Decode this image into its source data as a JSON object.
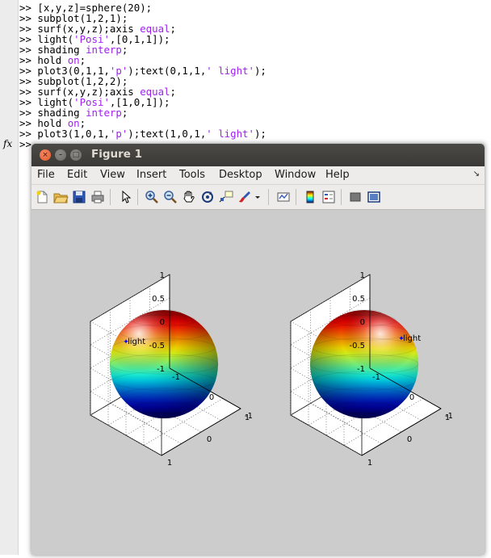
{
  "command_window": {
    "prompt": ">>",
    "fx_symbol": "fx",
    "lines": [
      [
        {
          "t": ">> [x,y,z]=sphere(20);"
        }
      ],
      [
        {
          "t": ">> subplot(1,2,1);"
        }
      ],
      [
        {
          "t": ">> surf(x,y,z);axis "
        },
        {
          "t": "equal",
          "c": "kw"
        },
        {
          "t": ";"
        }
      ],
      [
        {
          "t": ">> light("
        },
        {
          "t": "'Posi'",
          "c": "str"
        },
        {
          "t": ",[0,1,1]);"
        }
      ],
      [
        {
          "t": ">> shading "
        },
        {
          "t": "interp",
          "c": "kw"
        },
        {
          "t": ";"
        }
      ],
      [
        {
          "t": ">> hold "
        },
        {
          "t": "on",
          "c": "kw"
        },
        {
          "t": ";"
        }
      ],
      [
        {
          "t": ">> plot3(0,1,1,"
        },
        {
          "t": "'p'",
          "c": "str"
        },
        {
          "t": ");text(0,1,1,"
        },
        {
          "t": "' light'",
          "c": "str"
        },
        {
          "t": ");"
        }
      ],
      [
        {
          "t": ">> subplot(1,2,2);"
        }
      ],
      [
        {
          "t": ">> surf(x,y,z);axis "
        },
        {
          "t": "equal",
          "c": "kw"
        },
        {
          "t": ";"
        }
      ],
      [
        {
          "t": ">> light("
        },
        {
          "t": "'Posi'",
          "c": "str"
        },
        {
          "t": ",[1,0,1]);"
        }
      ],
      [
        {
          "t": ">> shading "
        },
        {
          "t": "interp",
          "c": "kw"
        },
        {
          "t": ";"
        }
      ],
      [
        {
          "t": ">> hold "
        },
        {
          "t": "on",
          "c": "kw"
        },
        {
          "t": ";"
        }
      ],
      [
        {
          "t": ">> plot3(1,0,1,"
        },
        {
          "t": "'p'",
          "c": "str"
        },
        {
          "t": ");text(1,0,1,"
        },
        {
          "t": "' light'",
          "c": "str"
        },
        {
          "t": ");"
        }
      ],
      [
        {
          "t": ">>"
        }
      ]
    ]
  },
  "figure": {
    "title": "Figure 1",
    "close_glyph": "×",
    "min_glyph": "–",
    "max_glyph": "□",
    "menus": [
      {
        "key": "file",
        "label": "File"
      },
      {
        "key": "edit",
        "label": "Edit"
      },
      {
        "key": "view",
        "label": "View"
      },
      {
        "key": "insert",
        "label": "Insert"
      },
      {
        "key": "tools",
        "label": "Tools"
      },
      {
        "key": "desktop",
        "label": "Desktop"
      },
      {
        "key": "window",
        "label": "Window"
      },
      {
        "key": "help",
        "label": "Help"
      }
    ],
    "menu_more_glyph": "↘",
    "toolbar": [
      {
        "key": "new",
        "icon": "new-figure-icon"
      },
      {
        "key": "open",
        "icon": "open-file-icon"
      },
      {
        "key": "save",
        "icon": "save-icon"
      },
      {
        "key": "print",
        "icon": "print-icon"
      },
      {
        "key": "edit-plot",
        "icon": "pointer-icon"
      },
      {
        "key": "zoom-in",
        "icon": "zoom-in-icon"
      },
      {
        "key": "zoom-out",
        "icon": "zoom-out-icon"
      },
      {
        "key": "pan",
        "icon": "pan-hand-icon"
      },
      {
        "key": "rotate",
        "icon": "rotate-3d-icon"
      },
      {
        "key": "data-cursor",
        "icon": "data-cursor-icon"
      },
      {
        "key": "brush",
        "icon": "brush-icon"
      },
      {
        "key": "link",
        "icon": "link-plot-icon"
      },
      {
        "key": "colorbar",
        "icon": "colorbar-icon"
      },
      {
        "key": "legend",
        "icon": "legend-icon"
      },
      {
        "key": "hide-tools",
        "icon": "hide-plot-tools-icon"
      },
      {
        "key": "show-tools",
        "icon": "show-plot-tools-icon"
      }
    ]
  },
  "chart_data": [
    {
      "type": "surface",
      "surface": "sphere(20)",
      "shading": "interp",
      "colormap": "jet",
      "light_position": [
        0,
        1,
        1
      ],
      "light_marker": "p",
      "annotation": " light",
      "axis": "equal",
      "grid": true,
      "xlim": [
        -1,
        1
      ],
      "ylim": [
        -1,
        1
      ],
      "zlim": [
        -1,
        1
      ],
      "z_ticks": [
        "1",
        "0.5",
        "0",
        "-0.5",
        "-1"
      ],
      "x_ticks": [
        "-1",
        "0",
        "1"
      ],
      "y_ticks": [
        "-1",
        "0",
        "1"
      ]
    },
    {
      "type": "surface",
      "surface": "sphere(20)",
      "shading": "interp",
      "colormap": "jet",
      "light_position": [
        1,
        0,
        1
      ],
      "light_marker": "p",
      "annotation": " light",
      "axis": "equal",
      "grid": true,
      "xlim": [
        -1,
        1
      ],
      "ylim": [
        -1,
        1
      ],
      "zlim": [
        -1,
        1
      ],
      "z_ticks": [
        "1",
        "0.5",
        "0",
        "-0.5",
        "-1"
      ],
      "x_ticks": [
        "-1",
        "0",
        "1"
      ],
      "y_ticks": [
        "-1",
        "0",
        "1"
      ]
    }
  ]
}
